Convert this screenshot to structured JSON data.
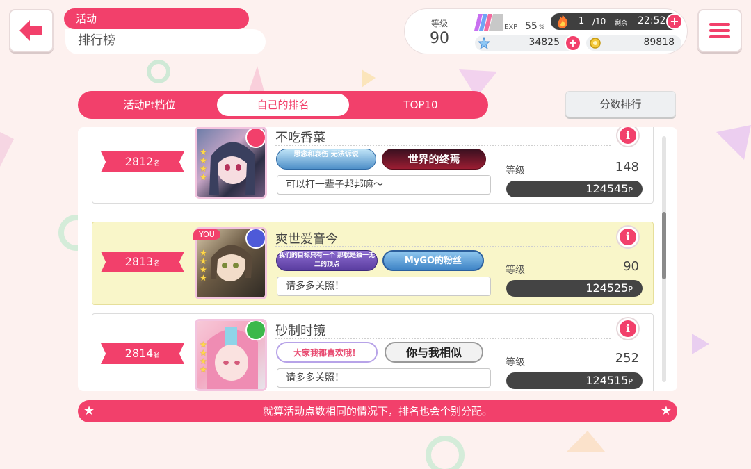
{
  "header": {
    "category": "活动",
    "title": "排行榜"
  },
  "status": {
    "level_label": "等级",
    "level": "90",
    "exp_label": "EXP",
    "exp_percent": "55",
    "exp_unit": "%",
    "stamina_count": "1",
    "stamina_max": "/10",
    "remaining_label": "剩余",
    "remaining_time": "22:52",
    "star_gems": "34825",
    "coins": "89818"
  },
  "tabs": [
    {
      "label": "活动Pt档位",
      "active": false
    },
    {
      "label": "自己的排名",
      "active": true
    },
    {
      "label": "TOP10",
      "active": false
    }
  ],
  "sort_button": "分数排行",
  "rows": [
    {
      "rank": "2812",
      "rank_suffix": "名",
      "name": "不吃香菜",
      "badge1": "思念和哀伤 无法诉说",
      "badge2": "世界的终焉",
      "comment": "可以打一辈子邦邦嘛～",
      "level_label": "等级",
      "level": "148",
      "points": "124545",
      "points_unit": "P",
      "is_me": false
    },
    {
      "rank": "2813",
      "rank_suffix": "名",
      "name": "爽世爱音今",
      "badge1": "我们的目标只有一个 那就是独一无二的顶点",
      "badge2": "MyGO的粉丝",
      "comment": "请多多关照！",
      "level_label": "等级",
      "level": "90",
      "points": "124525",
      "points_unit": "P",
      "is_me": true,
      "you_label": "YOU"
    },
    {
      "rank": "2814",
      "rank_suffix": "名",
      "name": "砂制时镜",
      "badge1": "大家我都喜欢哦！",
      "badge2": "你与我相似",
      "comment": "请多多关照！",
      "level_label": "等级",
      "level": "252",
      "points": "124515",
      "points_unit": "P",
      "is_me": false
    }
  ],
  "notice": "就算活动点数相同的情况下，排名也会个别分配。",
  "colors": {
    "accent": "#f2406b",
    "background": "#fdf1ef",
    "my_row": "#f9f6c9"
  }
}
